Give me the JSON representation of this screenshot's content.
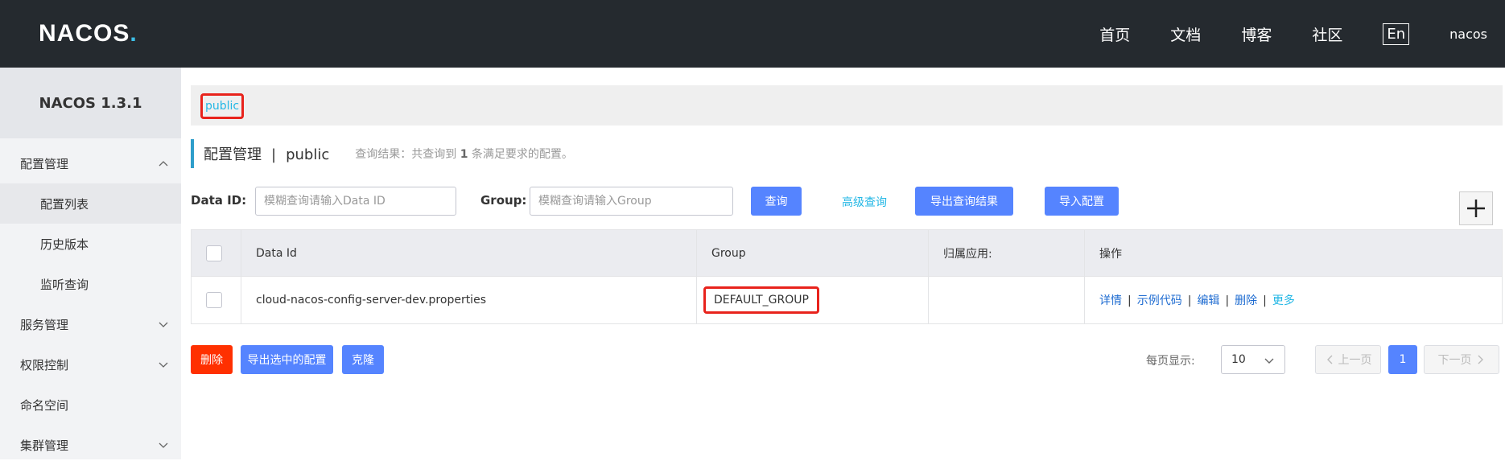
{
  "header": {
    "logo_text": "NACOS",
    "logo_dot": ".",
    "nav": [
      "首页",
      "文档",
      "博客",
      "社区"
    ],
    "lang": "En",
    "user": "nacos"
  },
  "sidebar": {
    "version": "NACOS 1.3.1",
    "items": [
      {
        "label": "配置管理"
      },
      {
        "label": "配置列表"
      },
      {
        "label": "历史版本"
      },
      {
        "label": "监听查询"
      },
      {
        "label": "服务管理"
      },
      {
        "label": "权限控制"
      },
      {
        "label": "命名空间"
      },
      {
        "label": "集群管理"
      }
    ]
  },
  "namespace": {
    "current": "public"
  },
  "title": {
    "main": "配置管理",
    "sep": "|",
    "ns": "public",
    "result_prefix": "查询结果：共查询到",
    "result_count": "1",
    "result_suffix": "条满足要求的配置。"
  },
  "search": {
    "dataid_label": "Data ID:",
    "dataid_placeholder": "模糊查询请输入Data ID",
    "group_label": "Group:",
    "group_placeholder": "模糊查询请输入Group",
    "query": "查询",
    "advanced": "高级查询",
    "export": "导出查询结果",
    "import": "导入配置"
  },
  "table": {
    "headers": [
      "Data Id",
      "Group",
      "归属应用:",
      "操作"
    ],
    "rows": [
      {
        "data_id": "cloud-nacos-config-server-dev.properties",
        "group": "DEFAULT_GROUP",
        "app": ""
      }
    ],
    "ops": [
      "详情",
      "示例代码",
      "编辑",
      "删除"
    ],
    "more": "更多",
    "op_sep": "|"
  },
  "bottom": {
    "delete": "删除",
    "export_selected": "导出选中的配置",
    "clone": "克隆",
    "page_size_label": "每页显示:",
    "page_size": "10",
    "prev": "上一页",
    "current_page": "1",
    "next": "下一页"
  },
  "colors": {
    "primary": "#5584ff",
    "danger": "#ff3000",
    "highlight": "#e8231c",
    "link": "#23b7e5"
  }
}
